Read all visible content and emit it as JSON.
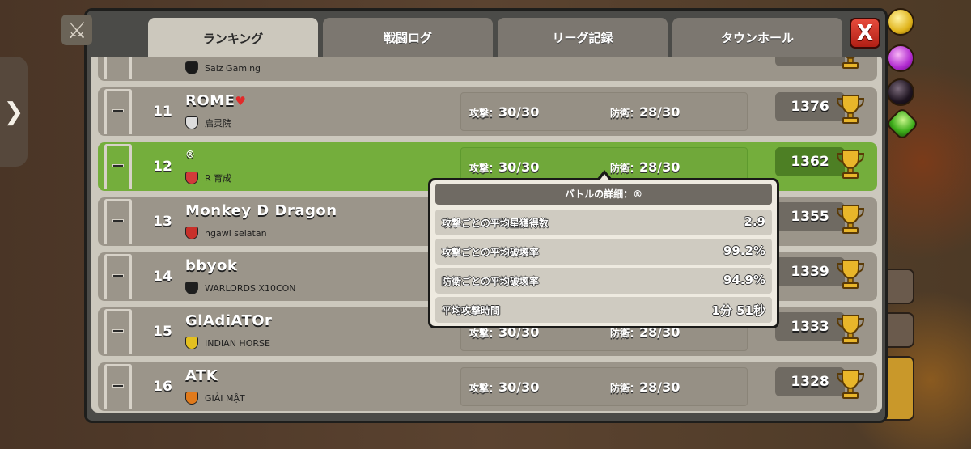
{
  "tabs": [
    {
      "label": "ランキング",
      "active": true
    },
    {
      "label": "戦闘ログ"
    },
    {
      "label": "リーグ記録"
    },
    {
      "label": "タウンホール"
    }
  ],
  "close_label": "X",
  "side_tab_chevron": "❯",
  "partial_row": {
    "clan": "Salz Gaming"
  },
  "rows": [
    {
      "rank": "11",
      "name": "ROME",
      "heart": "♥",
      "clan": "启灵院",
      "attack_label": "攻撃：",
      "attack": "30/30",
      "defense_label": "防衛：",
      "defense": "28/30",
      "trophies": "1376"
    },
    {
      "rank": "12",
      "name": "®",
      "clan": "R 育成",
      "attack_label": "攻撃：",
      "attack": "30/30",
      "defense_label": "防衛：",
      "defense": "28/30",
      "trophies": "1362"
    },
    {
      "rank": "13",
      "name": "Monkey D Dragon",
      "clan": "ngawi selatan",
      "trophies": "1355"
    },
    {
      "rank": "14",
      "name": "bbyok",
      "clan": "WARLORDS X10CON",
      "trophies": "1339"
    },
    {
      "rank": "15",
      "name": "GlAdiATOr",
      "clan": "INDIAN HORSE",
      "attack_label": "攻撃：",
      "attack": "30/30",
      "defense_label": "防衛：",
      "defense": "28/30",
      "trophies": "1333"
    },
    {
      "rank": "16",
      "name": "ATK",
      "clan": "GIẢI MẬT",
      "attack_label": "攻撃：",
      "attack": "30/30",
      "defense_label": "防衛：",
      "defense": "28/30",
      "trophies": "1328"
    }
  ],
  "popup": {
    "title": "バトルの詳細：®",
    "items": [
      {
        "label": "攻撃ごとの平均星獲得数",
        "value": "2.9"
      },
      {
        "label": "攻撃ごとの平均破壊率",
        "value": "99.2%"
      },
      {
        "label": "防衛ごとの平均破壊率",
        "value": "94.9%"
      },
      {
        "label": "平均攻撃時間",
        "value": "1分 51秒"
      }
    ]
  },
  "colors": {
    "highlight_row": "#74ae3c",
    "row": "#9b958a",
    "panel_bg": "#ccc8bd",
    "close_button": "#d43a2c"
  },
  "icons": [
    "crossed-swords-icon",
    "trophy-icon",
    "clan-badge-icon",
    "league-shield-icon",
    "gold-icon",
    "elixir-icon",
    "dark-elixir-icon",
    "gem-icon",
    "close-icon",
    "chevron-right-icon"
  ]
}
